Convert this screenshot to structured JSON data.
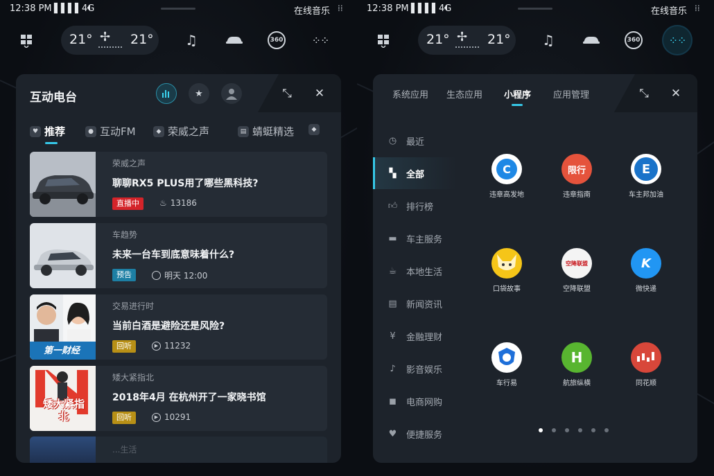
{
  "status_bar": {
    "time": "12:38 PM",
    "signal": "4G",
    "online_music": "在线音乐"
  },
  "climate": {
    "left_temp": "21°",
    "right_temp": "21°"
  },
  "top_icons": [
    "windows-icon",
    "music-note-icon",
    "car-icon",
    "view-360-icon",
    "apps-grid-icon"
  ],
  "view_360_label": "360",
  "radio_panel": {
    "title": "互动电台",
    "tabs": [
      {
        "label": "推荐",
        "active": true
      },
      {
        "label": "互动FM",
        "active": false
      },
      {
        "label": "荣威之声",
        "active": false
      },
      {
        "label": "蜻蜓精选",
        "active": false
      }
    ],
    "cards": [
      {
        "source": "荣威之声",
        "title": "聊聊RX5 PLUS用了哪些黑科技?",
        "badge": "直播中",
        "meta": "13186"
      },
      {
        "source": "车趋势",
        "title": "未来一台车到底意味着什么?",
        "badge": "预告",
        "meta": "明天 12:00"
      },
      {
        "source": "交易进行时",
        "title": "当前白酒是避险还是风险?",
        "badge": "回听",
        "meta": "11232"
      },
      {
        "source": "矮大紧指北",
        "title": "2018年4月 在杭州开了一家晓书馆",
        "badge": "回听",
        "meta": "10291"
      }
    ],
    "thumb_texts": {
      "card3": "第一财经",
      "card4": "矮大紧指北"
    },
    "peek_text": "...生活"
  },
  "apps_panel": {
    "tabs": [
      {
        "label": "系统应用",
        "active": false
      },
      {
        "label": "生态应用",
        "active": false
      },
      {
        "label": "小程序",
        "active": true
      },
      {
        "label": "应用管理",
        "active": false
      }
    ],
    "categories": [
      {
        "label": "最近",
        "icon": "clock-icon",
        "active": false
      },
      {
        "label": "全部",
        "icon": "grid-icon",
        "active": true
      },
      {
        "label": "排行榜",
        "icon": "thumbs-up-icon",
        "active": false
      },
      {
        "label": "车主服务",
        "icon": "car-icon",
        "active": false
      },
      {
        "label": "本地生活",
        "icon": "coffee-icon",
        "active": false
      },
      {
        "label": "新闻资讯",
        "icon": "book-icon",
        "active": false
      },
      {
        "label": "金融理财",
        "icon": "yen-icon",
        "active": false
      },
      {
        "label": "影音娱乐",
        "icon": "music-icon",
        "active": false
      },
      {
        "label": "电商网购",
        "icon": "shopping-bag-icon",
        "active": false
      },
      {
        "label": "便捷服务",
        "icon": "heart-icon",
        "active": false
      }
    ],
    "apps": [
      {
        "label": "违章高发地",
        "icon_text": "C",
        "color": "#1e88e5"
      },
      {
        "label": "违章指南",
        "icon_text": "限行",
        "color": "#e5533c"
      },
      {
        "label": "车主邦加油",
        "icon_text": "E",
        "color": "#1a73c9"
      },
      {
        "label": "口袋故事",
        "icon_text": "",
        "color": "#f5c518"
      },
      {
        "label": "空降联盟",
        "icon_text": "空降联盟",
        "color": "#f4f4f4"
      },
      {
        "label": "微快递",
        "icon_text": "K",
        "color": "#2196f3"
      },
      {
        "label": "车行易",
        "icon_text": "",
        "color": "#1e6fd9"
      },
      {
        "label": "航旅纵横",
        "icon_text": "H",
        "color": "#58b530"
      },
      {
        "label": "同花顺",
        "icon_text": "",
        "color": "#d8473a"
      }
    ],
    "page_dots": 6,
    "active_dot": 0
  }
}
